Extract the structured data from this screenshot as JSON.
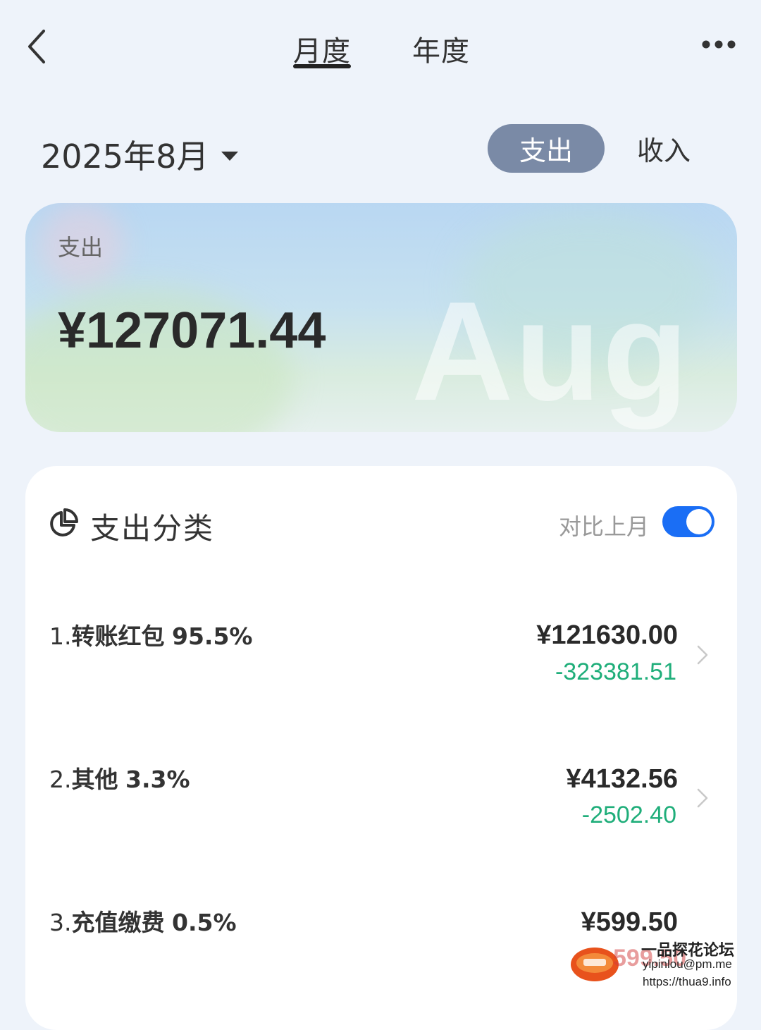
{
  "nav": {
    "tab_month": "月度",
    "tab_year": "年度",
    "active_tab": "月度"
  },
  "period": {
    "label": "2025年8月"
  },
  "segment": {
    "expense": "支出",
    "income": "收入",
    "active": "支出"
  },
  "summary": {
    "label": "支出",
    "amount": "¥127071.44",
    "month_word": "Aug"
  },
  "categories": {
    "title": "支出分类",
    "compare_label": "对比上月",
    "compare_on": true,
    "items": [
      {
        "index": "1.",
        "name": "转账红包",
        "percent": "95.5%",
        "amount": "¥121630.00",
        "diff": "-323381.51"
      },
      {
        "index": "2.",
        "name": "其他",
        "percent": "3.3%",
        "amount": "¥4132.56",
        "diff": "-2502.40"
      },
      {
        "index": "3.",
        "name": "充值缴费",
        "percent": "0.5%",
        "amount": "¥599.50",
        "diff": ""
      }
    ]
  },
  "watermark": {
    "site_name": "一品探花论坛",
    "email": "yipinlou@pm.me",
    "url": "https://thua9.info",
    "number": "599.50"
  },
  "colors": {
    "segment_active": "#7a8aa6",
    "toggle_on": "#1a6ef5",
    "diff_green": "#1fae7a"
  }
}
